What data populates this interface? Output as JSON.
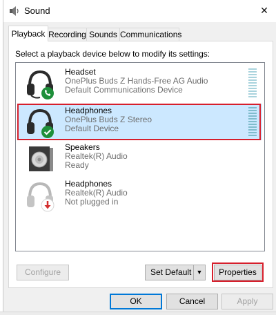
{
  "window": {
    "title": "Sound",
    "close_glyph": "✕",
    "icons": {
      "title": "speaker-icon",
      "close": "close-icon"
    }
  },
  "tabs": [
    {
      "label": "Playback",
      "active": true
    },
    {
      "label": "Recording",
      "active": false
    },
    {
      "label": "Sounds",
      "active": false
    },
    {
      "label": "Communications",
      "active": false
    }
  ],
  "instruction": "Select a playback device below to modify its settings:",
  "devices": [
    {
      "name": "Headset",
      "line2": "OnePlus Buds Z Hands-Free AG Audio",
      "line3": "Default Communications Device",
      "icon": "headset-phone-icon",
      "selected": false
    },
    {
      "name": "Headphones",
      "line2": "OnePlus Buds Z Stereo",
      "line3": "Default Device",
      "icon": "headphones-default-icon",
      "selected": true
    },
    {
      "name": "Speakers",
      "line2": "Realtek(R) Audio",
      "line3": "Ready",
      "icon": "speaker-box-icon",
      "selected": false
    },
    {
      "name": "Headphones",
      "line2": "Realtek(R) Audio",
      "line3": "Not plugged in",
      "icon": "headphones-unplugged-icon",
      "selected": false
    }
  ],
  "buttons": {
    "configure": "Configure",
    "set_default": "Set Default",
    "set_default_arrow": "▼",
    "properties": "Properties",
    "ok": "OK",
    "cancel": "Cancel",
    "apply": "Apply"
  },
  "colors": {
    "selection": "#cce8ff",
    "highlight_outline": "#d61f2c",
    "check_green": "#1e8f3a",
    "unplugged_red": "#d32f2f"
  }
}
